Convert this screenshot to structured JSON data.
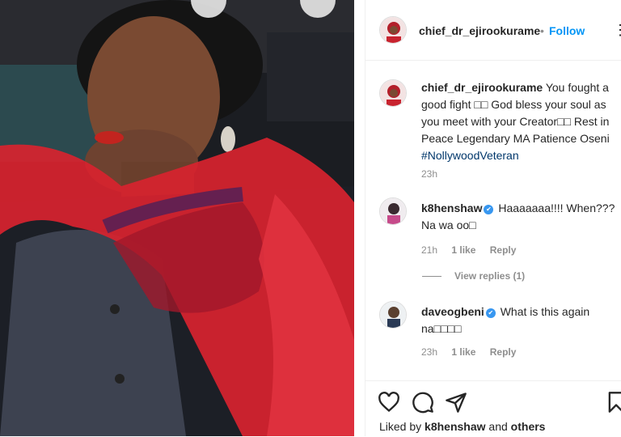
{
  "post": {
    "author": "chief_dr_ejirookurame",
    "dot": "•",
    "follow_label": "Follow",
    "more_label": "⋮"
  },
  "caption": {
    "username": "chief_dr_ejirookurame",
    "text": "You fought a good fight □□ God bless your soul as you meet with your Creator□□ Rest in Peace Legendary MA Patience Oseni",
    "hashtag": "#NollywoodVeteran",
    "time": "23h"
  },
  "comments": [
    {
      "username": "k8henshaw",
      "verified": "✔",
      "text": "Haaaaaaa!!!! When??? Na wa oo□",
      "time": "21h",
      "likes": "1 like",
      "reply": "Reply"
    },
    {
      "username": "daveogbeni",
      "verified": "✔",
      "text": "What is this again na□□□□",
      "time": "23h",
      "likes": "1 like",
      "reply": "Reply"
    }
  ],
  "view_replies": "View replies (1)",
  "footer": {
    "liked_prefix": "Liked by",
    "liked_user": "k8henshaw",
    "liked_suffix": "and",
    "liked_others": "others"
  },
  "icons": {
    "like": "heart-icon",
    "comment": "comment-icon",
    "share": "share-icon",
    "save": "bookmark-icon"
  },
  "colors": {
    "follow": "#0095f6",
    "verified": "#3897f0",
    "hashtag": "#00376b",
    "muted": "#8e8e8e"
  }
}
